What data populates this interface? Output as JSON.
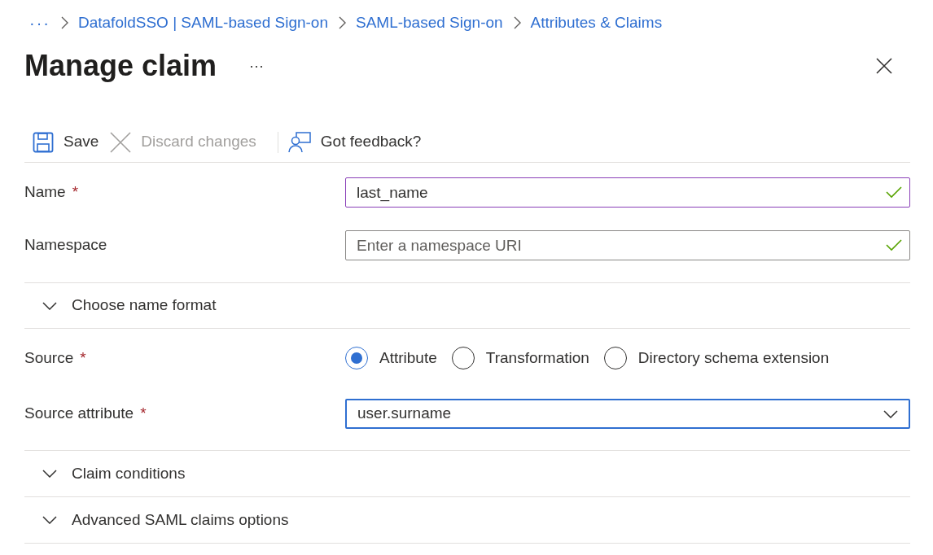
{
  "breadcrumb": {
    "overflow": "···",
    "items": [
      "DatafoldSSO | SAML-based Sign-on",
      "SAML-based Sign-on",
      "Attributes & Claims"
    ]
  },
  "title": "Manage claim",
  "title_more": "···",
  "toolbar": [
    {
      "kind": "save",
      "label": "Save",
      "disabled": false
    },
    {
      "kind": "discard",
      "label": "Discard changes",
      "disabled": true
    },
    {
      "kind": "feedback",
      "label": "Got feedback?",
      "disabled": false
    }
  ],
  "fields": [
    {
      "label": "Name",
      "required_mark": "*",
      "value": "last_name",
      "hovered": true,
      "focused": false,
      "valid": true
    },
    {
      "label": "Namespace",
      "placeholder": "Enter a namespace URI",
      "hovered": false,
      "focused": false,
      "valid": true
    }
  ],
  "name_format": {
    "label": "Choose name format",
    "expanded": false
  },
  "source": {
    "label": "Source",
    "required_mark": "*",
    "options": [
      {
        "label": "Attribute",
        "selected": true
      },
      {
        "label": "Transformation",
        "selected": false
      },
      {
        "label": "Directory schema extension",
        "selected": false
      }
    ]
  },
  "source_attribute": {
    "label": "Source attribute",
    "required_mark": "*",
    "value": "user.surname",
    "focused": true
  },
  "sections": [
    {
      "label": "Claim conditions",
      "expanded": false
    },
    {
      "label": "Advanced SAML claims options",
      "expanded": false
    }
  ]
}
